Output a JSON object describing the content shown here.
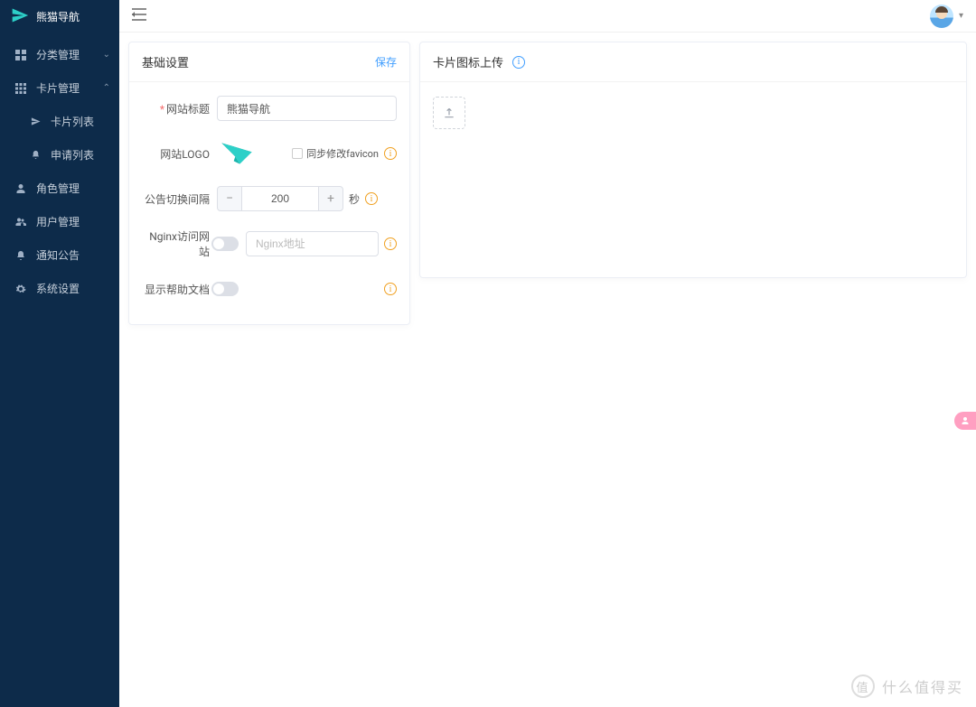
{
  "app": {
    "name": "熊猫导航"
  },
  "sidebar": {
    "items": [
      {
        "icon": "grid",
        "label": "分类管理",
        "chevron": "down"
      },
      {
        "icon": "grid4",
        "label": "卡片管理",
        "chevron": "up"
      },
      {
        "icon": "plane",
        "label": "卡片列表",
        "sub": true
      },
      {
        "icon": "bell",
        "label": "申请列表",
        "sub": true
      },
      {
        "icon": "user",
        "label": "角色管理"
      },
      {
        "icon": "users",
        "label": "用户管理"
      },
      {
        "icon": "bell",
        "label": "通知公告"
      },
      {
        "icon": "gear",
        "label": "系统设置"
      }
    ]
  },
  "settings": {
    "card_title": "基础设置",
    "save_label": "保存",
    "fields": {
      "site_title": {
        "label": "网站标题",
        "value": "熊猫导航",
        "required": true
      },
      "site_logo": {
        "label": "网站LOGO",
        "sync_label": "同步修改favicon"
      },
      "notice_interval": {
        "label": "公告切换间隔",
        "value": "200",
        "unit": "秒"
      },
      "nginx": {
        "label": "Nginx访问网站",
        "placeholder": "Nginx地址"
      },
      "help_doc": {
        "label": "显示帮助文档"
      }
    }
  },
  "upload": {
    "card_title": "卡片图标上传"
  },
  "watermark": {
    "circle": "值",
    "text": "什么值得买"
  }
}
